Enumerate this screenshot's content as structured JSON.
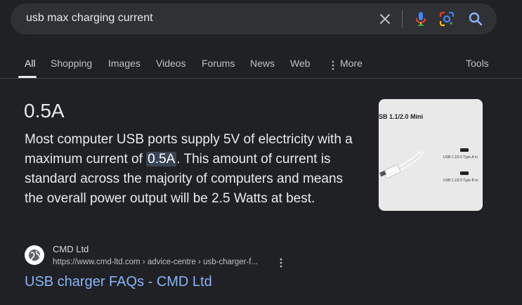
{
  "search": {
    "query": "usb max charging current",
    "icons": [
      "clear-icon",
      "microphone-icon",
      "google-lens-icon",
      "search-icon"
    ]
  },
  "tabs": {
    "items": [
      "All",
      "Shopping",
      "Images",
      "Videos",
      "Forums",
      "News",
      "Web",
      "More"
    ],
    "active": "All",
    "tools": "Tools"
  },
  "snippet": {
    "answer": "0.5A",
    "text_before": "Most computer USB ports supply 5V of electricity with a maximum current of ",
    "highlight": "0.5A",
    "text_after": ". This amount of current is standard across the majority of computers and means the overall power output will be 2.5 Watts at best."
  },
  "image": {
    "heading": "SB 1.1/2.0 Mini",
    "label_a": "USB 1.1/2.0 Type A m",
    "label_b": "USB 1.1/2.0 Type B m"
  },
  "source": {
    "name": "CMD Ltd",
    "url": "https://www.cmd-ltd.com › advice-centre › usb-charger-f...",
    "title": "USB charger FAQs - CMD Ltd"
  },
  "colors": {
    "background": "#202124",
    "search_bar": "#303134",
    "link": "#8ab4f8",
    "highlight": "#394457"
  }
}
